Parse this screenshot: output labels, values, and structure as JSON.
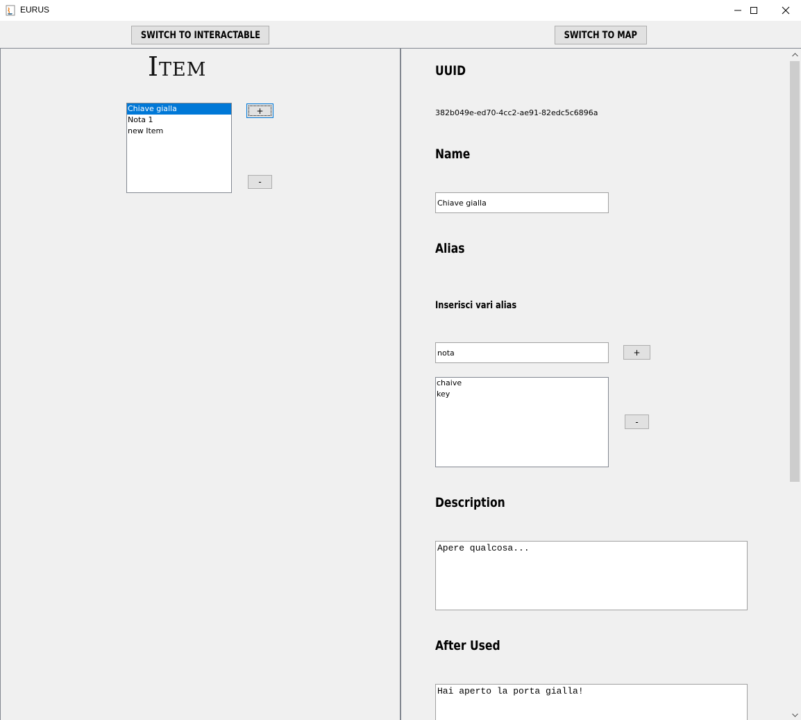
{
  "window": {
    "title": "EURUS"
  },
  "toolbar": {
    "switch_interactable_label": "SWITCH TO INTERACTABLE",
    "switch_map_label": "SWITCH TO MAP"
  },
  "left": {
    "heading": "Item",
    "items": [
      "Chiave gialla",
      "Nota 1",
      "new Item"
    ],
    "selected_index": 0,
    "add_label": "+",
    "remove_label": "-"
  },
  "detail": {
    "uuid_label": "UUID",
    "uuid_value": "382b049e-ed70-4cc2-ae91-82edc5c6896a",
    "name_label": "Name",
    "name_value": "Chiave gialla",
    "alias_label": "Alias",
    "alias_hint": "Inserisci vari alias",
    "alias_input_value": "nota",
    "alias_add_label": "+",
    "aliases": [
      "chaive",
      "key"
    ],
    "alias_remove_label": "-",
    "description_label": "Description",
    "description_value": "Apere qualcosa...",
    "after_used_label": "After Used",
    "after_used_value": "Hai aperto la porta gialla!"
  },
  "colors": {
    "selection": "#0078d7",
    "window_bg": "#f0f0f0",
    "button_bg": "#e1e1e1"
  }
}
